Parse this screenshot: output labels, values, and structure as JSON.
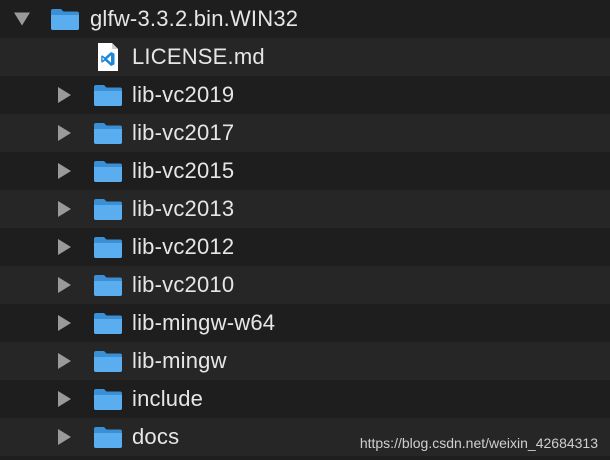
{
  "root": {
    "label": "glfw-3.3.2.bin.WIN32",
    "expanded": true
  },
  "items": [
    {
      "label": "LICENSE.md",
      "type": "file",
      "icon": "vscode-file-icon"
    },
    {
      "label": "lib-vc2019",
      "type": "folder"
    },
    {
      "label": "lib-vc2017",
      "type": "folder"
    },
    {
      "label": "lib-vc2015",
      "type": "folder"
    },
    {
      "label": "lib-vc2013",
      "type": "folder"
    },
    {
      "label": "lib-vc2012",
      "type": "folder"
    },
    {
      "label": "lib-vc2010",
      "type": "folder"
    },
    {
      "label": "lib-mingw-w64",
      "type": "folder"
    },
    {
      "label": "lib-mingw",
      "type": "folder"
    },
    {
      "label": "include",
      "type": "folder"
    },
    {
      "label": "docs",
      "type": "folder"
    }
  ],
  "watermark": "https://blog.csdn.net/weixin_42684313",
  "colors": {
    "background": "#1e1e1e",
    "row_alt": "#262626",
    "folder": "#4aa3e6",
    "text": "#e6e6e6",
    "disclosure": "#9a9a9a"
  }
}
